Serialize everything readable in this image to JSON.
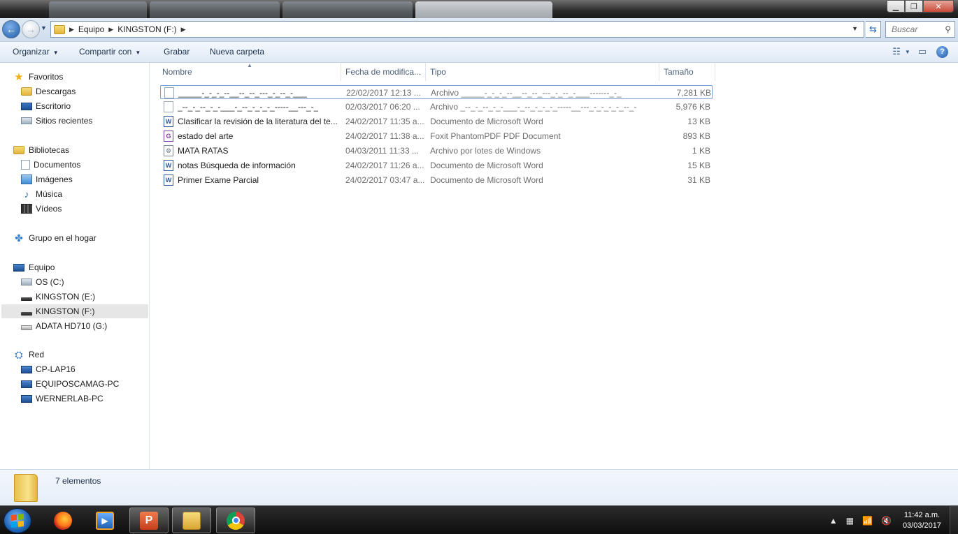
{
  "address": {
    "crumbs": [
      "Equipo",
      "KINGSTON (F:)"
    ]
  },
  "search": {
    "placeholder": "Buscar"
  },
  "toolbar": {
    "organize": "Organizar",
    "share": "Compartir con",
    "burn": "Grabar",
    "new_folder": "Nueva carpeta"
  },
  "navpane": {
    "favorites": {
      "label": "Favoritos",
      "items": [
        "Descargas",
        "Escritorio",
        "Sitios recientes"
      ]
    },
    "libraries": {
      "label": "Bibliotecas",
      "items": [
        "Documentos",
        "Imágenes",
        "Música",
        "Vídeos"
      ]
    },
    "homegroup": {
      "label": "Grupo en el hogar"
    },
    "computer": {
      "label": "Equipo",
      "items": [
        "OS (C:)",
        "KINGSTON (E:)",
        "KINGSTON (F:)",
        "ADATA HD710 (G:)"
      ]
    },
    "network": {
      "label": "Red",
      "items": [
        "CP-LAP16",
        "EQUIPOSCAMAG-PC",
        "WERNERLAB-PC"
      ]
    }
  },
  "columns": {
    "name": "Nombre",
    "date": "Fecha de modifica...",
    "type": "Tipo",
    "size": "Tamaño"
  },
  "files": [
    {
      "name": "_____-_-_-_--__--_--_---_-_--_-___",
      "date": "22/02/2017 12:13 ...",
      "type": "Archivo _____-_-_-_--__--_--_---_-_--_-___-------_-_",
      "size": "7,281 KB",
      "icon": "blank-file-icon"
    },
    {
      "name": "_--_-_--_-_-___-_--_-_-_-_-----__---_-_",
      "date": "02/03/2017 06:20 ...",
      "type": "Archivo _--_-_--_-_-___-_--_-_-_-_-----__---_-_-_-_-_--_-",
      "size": "5,976 KB",
      "icon": "blank-file-icon"
    },
    {
      "name": "Clasificar la revisión de la literatura del te...",
      "date": "24/02/2017 11:35 a...",
      "type": "Documento de Microsoft Word",
      "size": "13 KB",
      "icon": "word-document-icon"
    },
    {
      "name": "estado del arte",
      "date": "24/02/2017 11:38 a...",
      "type": "Foxit PhantomPDF PDF Document",
      "size": "893 KB",
      "icon": "pdf-document-icon"
    },
    {
      "name": "MATA RATAS",
      "date": "04/03/2011 11:33 ...",
      "type": "Archivo por lotes de Windows",
      "size": "1 KB",
      "icon": "batch-file-icon"
    },
    {
      "name": "notas Búsqueda de información",
      "date": "24/02/2017 11:26 a...",
      "type": "Documento de Microsoft Word",
      "size": "15 KB",
      "icon": "word-document-icon"
    },
    {
      "name": "Primer Exame Parcial",
      "date": "24/02/2017 03:47 a...",
      "type": "Documento de Microsoft Word",
      "size": "31 KB",
      "icon": "word-document-icon"
    }
  ],
  "status": {
    "item_count": "7 elementos"
  },
  "taskbar": {
    "clock_time": "11:42 a.m.",
    "clock_date": "03/03/2017",
    "apps": [
      "firefox-icon",
      "media-player-icon",
      "powerpoint-icon",
      "explorer-icon",
      "chrome-icon"
    ]
  }
}
